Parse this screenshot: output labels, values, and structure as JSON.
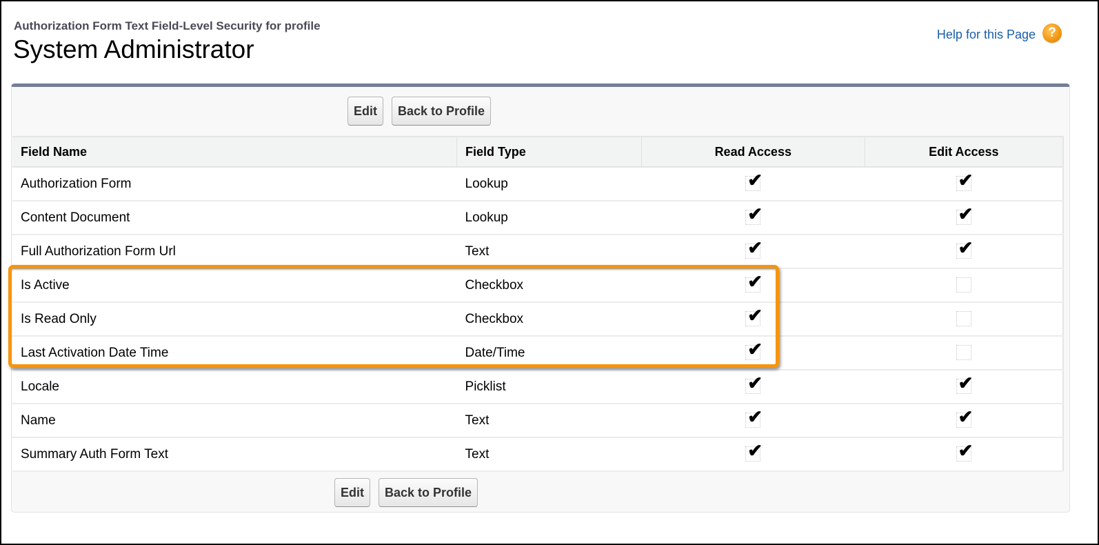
{
  "header": {
    "subtitle": "Authorization Form Text Field-Level Security for profile",
    "title": "System Administrator",
    "help_link": "Help for this Page",
    "help_icon": "question-mark-icon",
    "help_icon_glyph": "?"
  },
  "toolbar": {
    "edit_label": "Edit",
    "back_label": "Back to Profile"
  },
  "table": {
    "columns": [
      "Field Name",
      "Field Type",
      "Read Access",
      "Edit Access"
    ],
    "check_glyph": "✔",
    "rows": [
      {
        "name": "Authorization Form",
        "type": "Lookup",
        "read": true,
        "edit": true
      },
      {
        "name": "Content Document",
        "type": "Lookup",
        "read": true,
        "edit": true
      },
      {
        "name": "Full Authorization Form Url",
        "type": "Text",
        "read": true,
        "edit": true
      },
      {
        "name": "Is Active",
        "type": "Checkbox",
        "read": true,
        "edit": false
      },
      {
        "name": "Is Read Only",
        "type": "Checkbox",
        "read": true,
        "edit": false
      },
      {
        "name": "Last Activation Date Time",
        "type": "Date/Time",
        "read": true,
        "edit": false
      },
      {
        "name": "Locale",
        "type": "Picklist",
        "read": true,
        "edit": true
      },
      {
        "name": "Name",
        "type": "Text",
        "read": true,
        "edit": true
      },
      {
        "name": "Summary Auth Form Text",
        "type": "Text",
        "read": true,
        "edit": true
      }
    ]
  },
  "highlight": {
    "rows": [
      "Is Active",
      "Is Read Only",
      "Last Activation Date Time"
    ],
    "color": "#f7940d"
  },
  "colors": {
    "panel_top_border": "#747e96",
    "link": "#1a5ea8",
    "help_icon": "#f39a16"
  }
}
